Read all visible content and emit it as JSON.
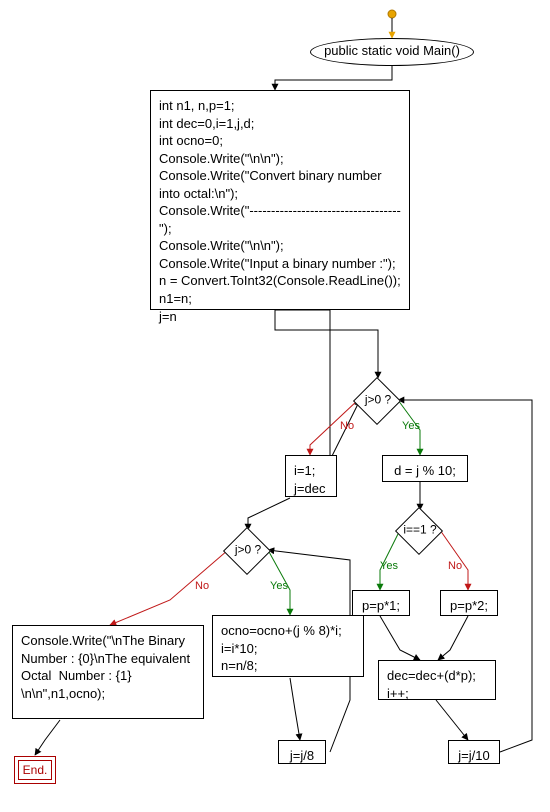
{
  "chart_data": {
    "type": "flowchart",
    "nodes": [
      {
        "id": "start",
        "kind": "start",
        "label": ""
      },
      {
        "id": "main",
        "kind": "ellipse",
        "label": "public static void Main()"
      },
      {
        "id": "init",
        "kind": "process",
        "label": "int n1, n,p=1;\nint dec=0,i=1,j,d;\nint ocno=0;\nConsole.Write(\"\\n\\n\");\nConsole.Write(\"Convert binary number into octal:\\n\");\nConsole.Write(\"-----------------------------------\");\nConsole.Write(\"\\n\\n\");\nConsole.Write(\"Input a binary number :\");\nn = Convert.ToInt32(Console.ReadLine());\nn1=n;\nj=n"
      },
      {
        "id": "d1",
        "kind": "decision",
        "label": "j>0 ?"
      },
      {
        "id": "b1",
        "kind": "process",
        "label": "d = j % 10;"
      },
      {
        "id": "d2",
        "kind": "decision",
        "label": "i==1 ?"
      },
      {
        "id": "p1",
        "kind": "process",
        "label": "p=p*1;"
      },
      {
        "id": "p2",
        "kind": "process",
        "label": "p=p*2;"
      },
      {
        "id": "b2",
        "kind": "process",
        "label": "dec=dec+(d*p);\ni++;"
      },
      {
        "id": "b3",
        "kind": "process",
        "label": "j=j/10"
      },
      {
        "id": "b4",
        "kind": "process",
        "label": "i=1;\nj=dec"
      },
      {
        "id": "d3",
        "kind": "decision",
        "label": "j>0 ?"
      },
      {
        "id": "b5",
        "kind": "process",
        "label": "ocno=ocno+(j % 8)*i;\ni=i*10;\nn=n/8;"
      },
      {
        "id": "b6",
        "kind": "process",
        "label": "j=j/8"
      },
      {
        "id": "out",
        "kind": "process",
        "label": "Console.Write(\"\\nThe Binary Number : {0}\\nThe equivalent Octal  Number : {1} \\n\\n\",n1,ocno);"
      },
      {
        "id": "end",
        "kind": "end",
        "label": "End."
      }
    ],
    "edges": [
      {
        "from": "start",
        "to": "main",
        "label": ""
      },
      {
        "from": "main",
        "to": "init",
        "label": ""
      },
      {
        "from": "init",
        "to": "d1",
        "label": ""
      },
      {
        "from": "d1",
        "to": "b1",
        "label": "Yes"
      },
      {
        "from": "d1",
        "to": "b4",
        "label": "No"
      },
      {
        "from": "b1",
        "to": "d2",
        "label": ""
      },
      {
        "from": "d2",
        "to": "p1",
        "label": "Yes"
      },
      {
        "from": "d2",
        "to": "p2",
        "label": "No"
      },
      {
        "from": "p1",
        "to": "b2",
        "label": ""
      },
      {
        "from": "p2",
        "to": "b2",
        "label": ""
      },
      {
        "from": "b2",
        "to": "b3",
        "label": ""
      },
      {
        "from": "b3",
        "to": "d1",
        "label": ""
      },
      {
        "from": "b4",
        "to": "d3",
        "label": ""
      },
      {
        "from": "d3",
        "to": "b5",
        "label": "Yes"
      },
      {
        "from": "d3",
        "to": "out",
        "label": "No"
      },
      {
        "from": "b5",
        "to": "b6",
        "label": ""
      },
      {
        "from": "b6",
        "to": "d3",
        "label": ""
      },
      {
        "from": "out",
        "to": "end",
        "label": ""
      }
    ]
  },
  "labels": {
    "yes": "Yes",
    "no": "No",
    "end": "End."
  }
}
